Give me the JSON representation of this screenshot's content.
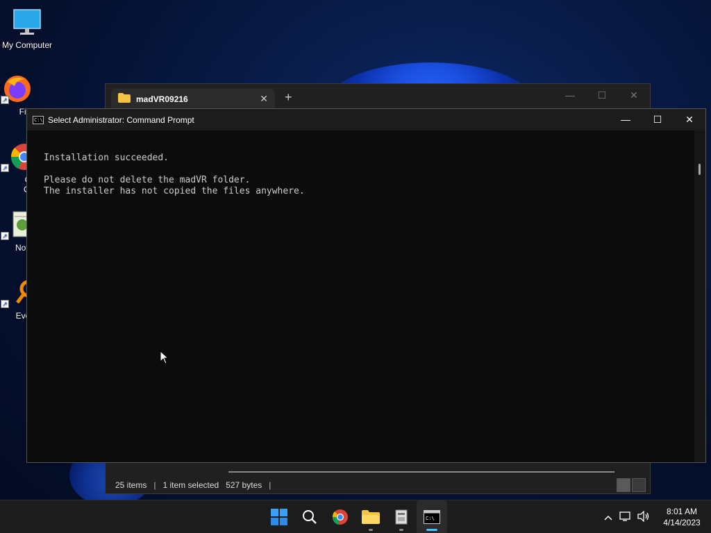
{
  "desktop": {
    "icons": [
      {
        "label": "My Computer"
      },
      {
        "label": "Fire"
      },
      {
        "label": "Goo Chro"
      },
      {
        "label": "Notep"
      },
      {
        "label": "Every"
      }
    ]
  },
  "explorer": {
    "tab_title": "madVR09216",
    "tab_close": "✕",
    "new_tab": "+",
    "min": "—",
    "max": "☐",
    "close": "✕",
    "status": {
      "items": "25 items",
      "selected": "1 item selected",
      "size": "527 bytes",
      "sep": "|"
    }
  },
  "cmd": {
    "title": "Select Administrator:  Command Prompt",
    "icon_text": "C:\\",
    "min": "—",
    "max": "☐",
    "close": "✕",
    "lines": [
      "Installation succeeded.",
      "",
      "Please do not delete the madVR folder.",
      "The installer has not copied the files anywhere."
    ]
  },
  "taskbar": {
    "time": "8:01 AM",
    "date": "4/14/2023",
    "tray_chevron": "^"
  },
  "colors": {
    "accent": "#4cc2ff",
    "console_bg": "#0c0c0c",
    "console_text": "#cccccc"
  }
}
